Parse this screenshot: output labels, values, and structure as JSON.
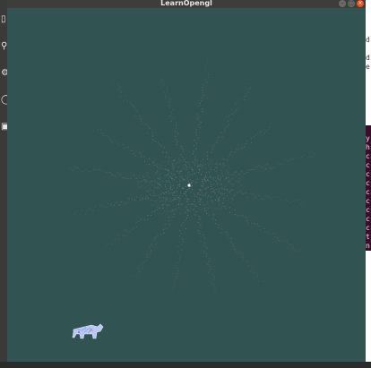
{
  "window": {
    "title": "LearnOpengl",
    "buttons": [
      "minimize",
      "maximize",
      "close"
    ]
  },
  "dock": {
    "icons": [
      "files-icon",
      "search-icon",
      "settings-icon",
      "help-icon",
      "terminal-icon"
    ]
  },
  "terminal": {
    "lines_top": [
      "",
      "d",
      "",
      "d",
      "e"
    ],
    "lines_mid": [
      "y",
      "h",
      "c",
      "c",
      "c",
      "c",
      "c",
      "c",
      "c",
      "c",
      "c",
      "t",
      "n"
    ]
  },
  "scene": {
    "background": "#315452",
    "description_colors": [
      "#6b7a6a",
      "#7f6a86",
      "#5d8a80",
      "#8a7a60"
    ]
  }
}
